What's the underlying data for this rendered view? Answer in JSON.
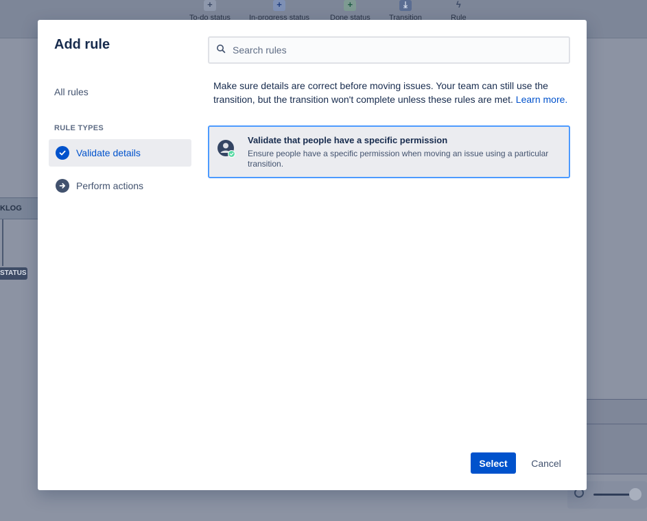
{
  "background": {
    "toolbar": [
      {
        "label": "To-do status",
        "icon": "plus-icon"
      },
      {
        "label": "In-progress status",
        "icon": "plus-icon"
      },
      {
        "label": "Done status",
        "icon": "plus-icon"
      },
      {
        "label": "Transition",
        "icon": "transition-icon"
      },
      {
        "label": "Rule",
        "icon": "lightning-icon"
      }
    ],
    "node_backlog": "KLOG",
    "status_chip": "STATUS"
  },
  "modal": {
    "title": "Add rule",
    "nav": {
      "all_rules": "All rules",
      "heading": "RULE TYPES",
      "items": [
        {
          "label": "Validate details",
          "icon": "check-circle-icon",
          "selected": true
        },
        {
          "label": "Perform actions",
          "icon": "arrow-right-circle-icon",
          "selected": false
        }
      ]
    },
    "search": {
      "placeholder": "Search rules",
      "value": ""
    },
    "description": {
      "text": "Make sure details are correct before moving issues. Your team can still use the transition, but the transition won't complete unless these rules are met.",
      "link": "Learn more."
    },
    "rules": [
      {
        "title": "Validate that people have a specific permission",
        "description": "Ensure people have a specific permission when moving an issue using a particular transition.",
        "icon": "user-permission-icon",
        "selected": true
      }
    ],
    "footer": {
      "select_label": "Select",
      "cancel_label": "Cancel"
    }
  },
  "colors": {
    "primary": "#0052CC",
    "selected_bg": "#EBECF0",
    "focus_border": "#4C9AFF",
    "text": "#172B4D",
    "overlay": "#8C93A3"
  }
}
